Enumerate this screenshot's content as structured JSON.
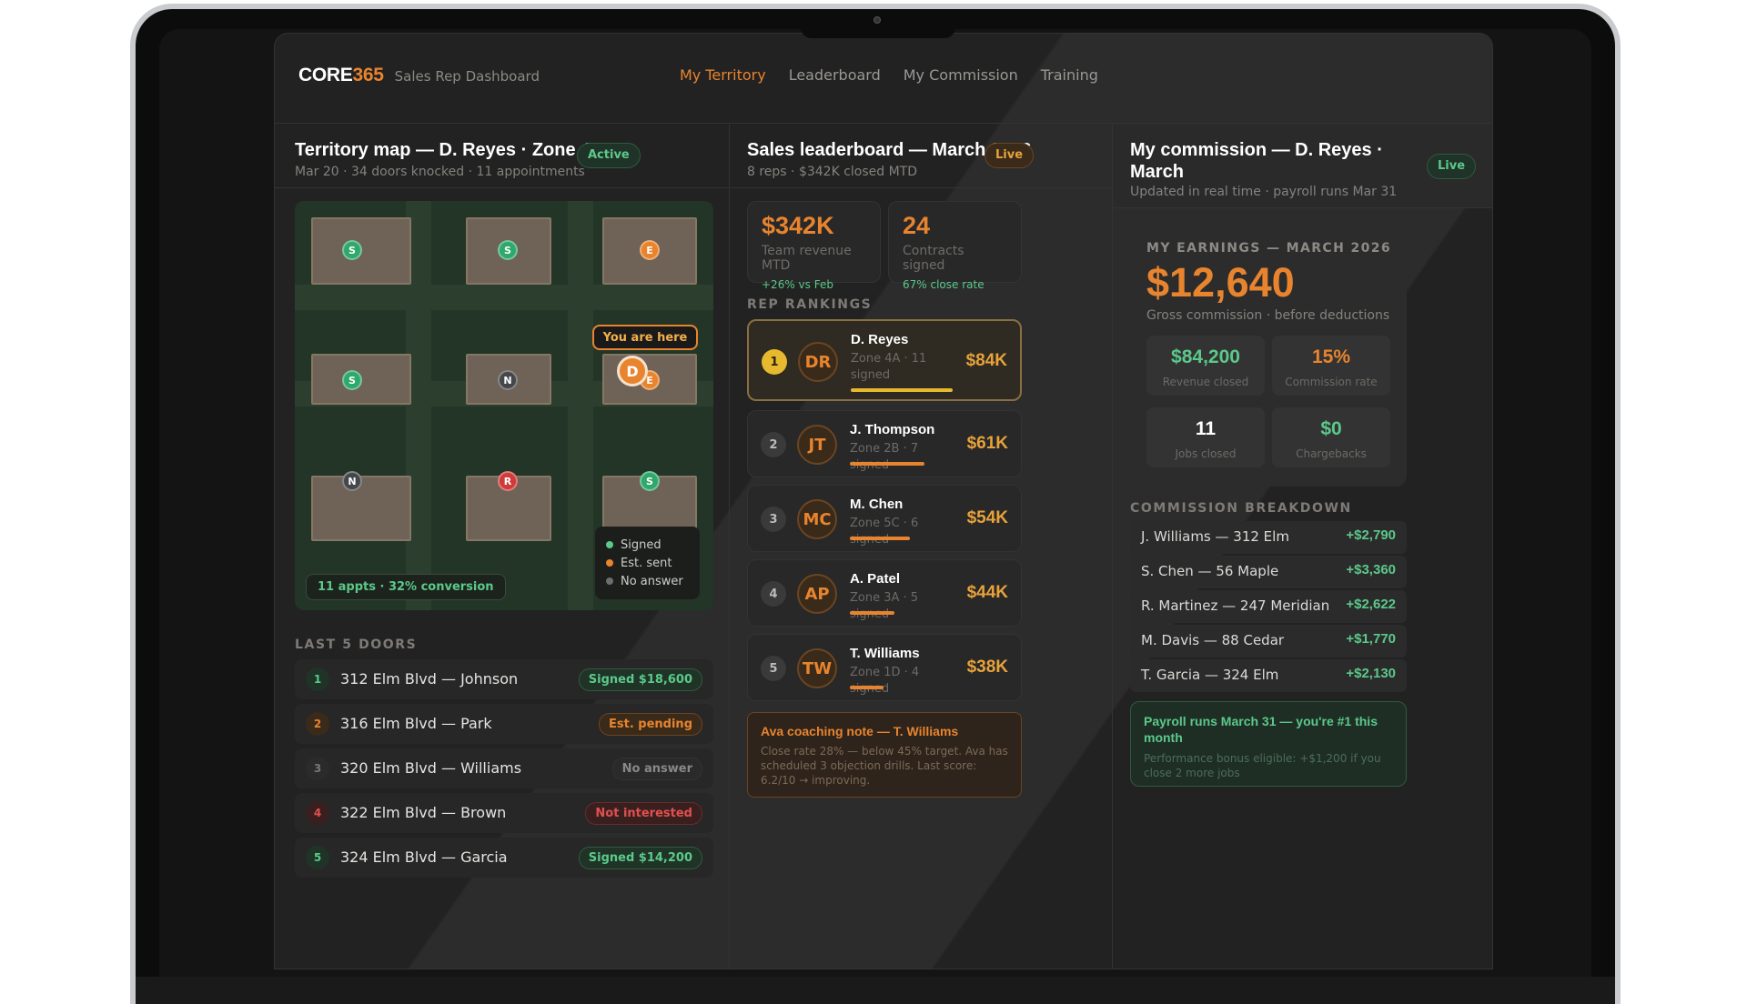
{
  "brand": {
    "name_a": "CORE",
    "name_b": "365",
    "subtitle": "Sales Rep Dashboard"
  },
  "nav": [
    "My Territory",
    "Leaderboard",
    "My Commission",
    "Training"
  ],
  "nav_active": "My Territory",
  "territory": {
    "title": "Territory map — D. Reyes · Zone 4A",
    "subtitle": "Mar 20 · 34 doors knocked · 11 appointments",
    "status": "Active",
    "markers": [
      "S",
      "S",
      "E",
      "S",
      "N",
      "E",
      "N",
      "R",
      "S"
    ],
    "you_are_here": "You are here",
    "you_initial": "D",
    "legend": [
      "Signed",
      "Est. sent",
      "No answer"
    ],
    "conversion": "11 appts · 32% conversion",
    "doors_label": "LAST 5 DOORS",
    "doors": [
      {
        "num": "1",
        "address": "312 Elm Blvd — Johnson",
        "status": "Signed $18,600"
      },
      {
        "num": "2",
        "address": "316 Elm Blvd — Park",
        "status": "Est. pending"
      },
      {
        "num": "3",
        "address": "320 Elm Blvd — Williams",
        "status": "No answer"
      },
      {
        "num": "4",
        "address": "322 Elm Blvd — Brown",
        "status": "Not interested"
      },
      {
        "num": "5",
        "address": "324 Elm Blvd — Garcia",
        "status": "Signed $14,200"
      }
    ]
  },
  "leaderboard": {
    "title": "Sales leaderboard — March 2026",
    "subtitle": "8 reps · $342K closed MTD",
    "status": "Live",
    "kpis": [
      {
        "value": "$342K",
        "label": "Team revenue MTD",
        "note": "+26% vs Feb"
      },
      {
        "value": "24",
        "label": "Contracts signed",
        "note": "67% close rate"
      }
    ],
    "rankings_label": "REP RANKINGS",
    "reps": [
      {
        "rank": "1",
        "initials": "DR",
        "name": "D. Reyes",
        "zone": "Zone 4A · 11 signed",
        "amount": "$84K",
        "progress": 1.0
      },
      {
        "rank": "2",
        "initials": "JT",
        "name": "J. Thompson",
        "zone": "Zone 2B · 7 signed",
        "amount": "$61K",
        "progress": 0.73
      },
      {
        "rank": "3",
        "initials": "MC",
        "name": "M. Chen",
        "zone": "Zone 5C · 6 signed",
        "amount": "$54K",
        "progress": 0.59
      },
      {
        "rank": "4",
        "initials": "AP",
        "name": "A. Patel",
        "zone": "Zone 3A · 5 signed",
        "amount": "$44K",
        "progress": 0.44
      },
      {
        "rank": "5",
        "initials": "TW",
        "name": "T. Williams",
        "zone": "Zone 1D · 4 signed",
        "amount": "$38K",
        "progress": 0.33
      }
    ],
    "coaching": {
      "title": "Ava coaching note — T. Williams",
      "body": "Close rate 28% — below 45% target. Ava has scheduled 3 objection drills. Last score: 6.2/10 → improving."
    }
  },
  "commission": {
    "title": "My commission — D. Reyes · March",
    "subtitle": "Updated in real time · payroll runs Mar 31",
    "status": "Live",
    "earnings_label": "MY EARNINGS — MARCH 2026",
    "earnings_value": "$12,640",
    "earnings_sub": "Gross commission · before deductions",
    "stats": [
      {
        "value": "$84,200",
        "label": "Revenue closed",
        "color": "#5bc98a"
      },
      {
        "value": "15%",
        "label": "Commission rate",
        "color": "#e8842e"
      },
      {
        "value": "11",
        "label": "Jobs closed",
        "color": "#ffffff"
      },
      {
        "value": "$0",
        "label": "Chargebacks",
        "color": "#5bc98a"
      }
    ],
    "breakdown_label": "COMMISSION BREAKDOWN",
    "breakdown": [
      {
        "name": "J. Williams — 312 Elm",
        "amount": "+$2,790"
      },
      {
        "name": "S. Chen — 56 Maple",
        "amount": "+$3,360"
      },
      {
        "name": "R. Martinez — 247 Meridian",
        "amount": "+$2,622"
      },
      {
        "name": "M. Davis — 88 Cedar",
        "amount": "+$1,770"
      },
      {
        "name": "T. Garcia — 324 Elm",
        "amount": "+$2,130"
      }
    ],
    "payroll": {
      "title": "Payroll runs March 31 — you're #1 this month",
      "body": "Performance bonus eligible: +$1,200 if you close 2 more jobs"
    }
  },
  "colors": {
    "accent": "#e8842e",
    "green": "#5bc98a",
    "gold": "#e6b92e",
    "red": "#d03a3a",
    "panel": "#222222"
  }
}
